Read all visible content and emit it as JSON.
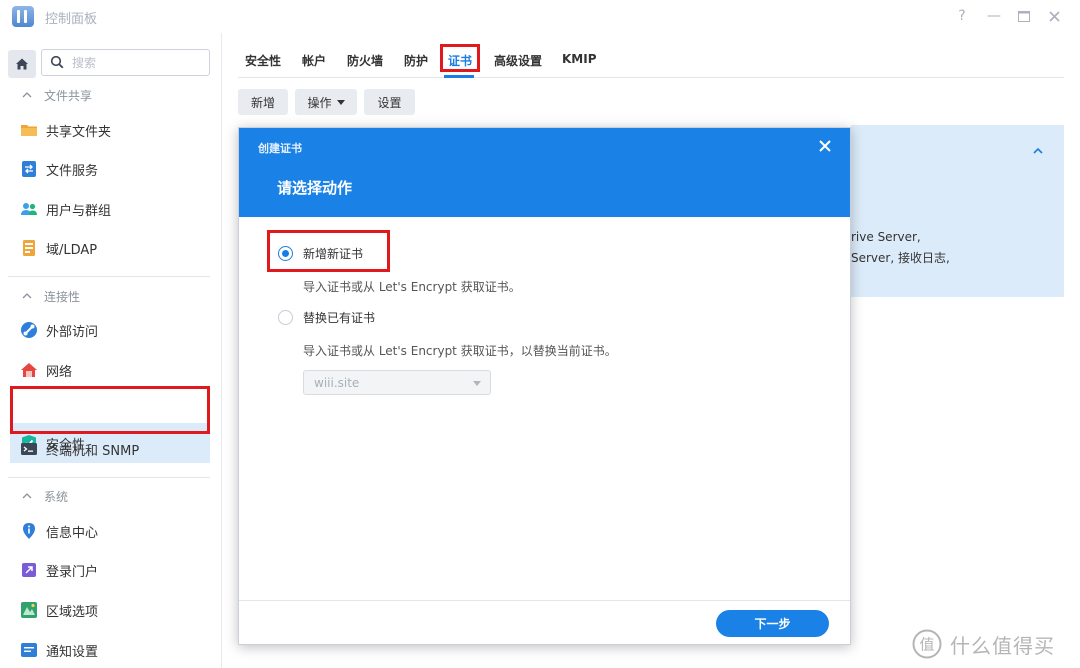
{
  "window": {
    "title": "控制面板",
    "controls": [
      "?",
      "—",
      "☐",
      "✕"
    ]
  },
  "sidebar": {
    "search_placeholder": "搜索",
    "sections": [
      {
        "label": "文件共享",
        "items": [
          {
            "label": "共享文件夹",
            "icon": "folder-icon"
          },
          {
            "label": "文件服务",
            "icon": "file-services-icon"
          },
          {
            "label": "用户与群组",
            "icon": "users-icon"
          },
          {
            "label": "域/LDAP",
            "icon": "domain-icon"
          }
        ]
      },
      {
        "label": "连接性",
        "items": [
          {
            "label": "外部访问",
            "icon": "external-access-icon"
          },
          {
            "label": "网络",
            "icon": "network-icon"
          },
          {
            "label": "安全性",
            "icon": "shield-icon",
            "active": true
          },
          {
            "label": "终端机和 SNMP",
            "icon": "terminal-icon"
          }
        ]
      },
      {
        "label": "系统",
        "items": [
          {
            "label": "信息中心",
            "icon": "info-icon"
          },
          {
            "label": "登录门户",
            "icon": "login-portal-icon"
          },
          {
            "label": "区域选项",
            "icon": "region-icon"
          },
          {
            "label": "通知设置",
            "icon": "notification-icon"
          }
        ]
      }
    ]
  },
  "tabs": [
    {
      "label": "安全性"
    },
    {
      "label": "帐户"
    },
    {
      "label": "防火墙"
    },
    {
      "label": "防护"
    },
    {
      "label": "证书",
      "active": true
    },
    {
      "label": "高级设置"
    },
    {
      "label": "KMIP"
    }
  ],
  "toolbar": {
    "add_label": "新增",
    "action_label": "操作",
    "settings_label": "设置"
  },
  "background_panel": {
    "line1": "rive Server,",
    "line2": "Server, 接收日志,"
  },
  "dialog": {
    "small_title": "创建证书",
    "title": "请选择动作",
    "options": [
      {
        "label": "新增新证书",
        "desc": "导入证书或从 Let's Encrypt 获取证书。",
        "checked": true
      },
      {
        "label": "替换已有证书",
        "desc": "导入证书或从 Let's Encrypt 获取证书，以替换当前证书。",
        "checked": false
      }
    ],
    "select_value": "wiii.site",
    "next_label": "下一步"
  },
  "watermark": {
    "text": "什么值得买",
    "logo_char": "值"
  },
  "colors": {
    "accent": "#1a82e6",
    "highlight_box": "#e0191c",
    "active_bg": "#dcebfa"
  }
}
